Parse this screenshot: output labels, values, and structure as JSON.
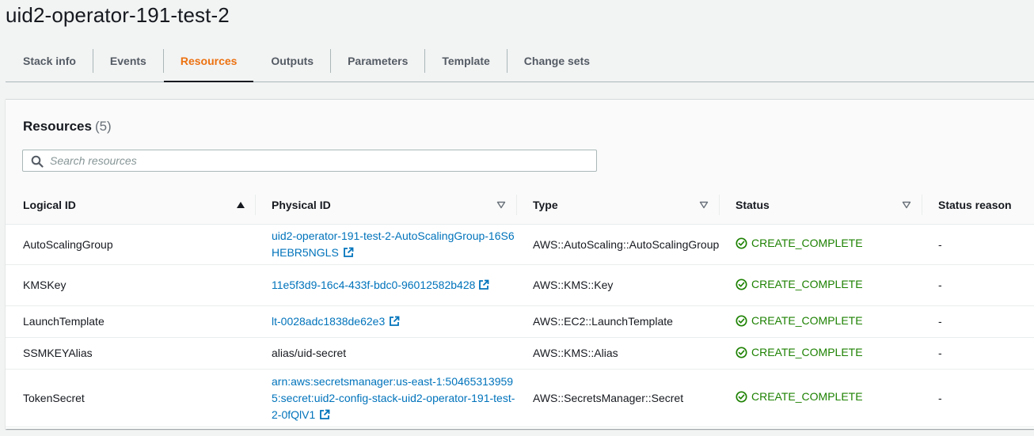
{
  "page": {
    "title": "uid2-operator-191-test-2"
  },
  "tabs": [
    {
      "label": "Stack info",
      "active": false
    },
    {
      "label": "Events",
      "active": false
    },
    {
      "label": "Resources",
      "active": true
    },
    {
      "label": "Outputs",
      "active": false
    },
    {
      "label": "Parameters",
      "active": false
    },
    {
      "label": "Template",
      "active": false
    },
    {
      "label": "Change sets",
      "active": false
    }
  ],
  "resources_panel": {
    "title": "Resources",
    "count": "(5)",
    "search_placeholder": "Search resources"
  },
  "table": {
    "columns": [
      {
        "label": "Logical ID",
        "sort": "ascending"
      },
      {
        "label": "Physical ID",
        "sort": "none"
      },
      {
        "label": "Type",
        "sort": "none"
      },
      {
        "label": "Status",
        "sort": "none"
      },
      {
        "label": "Status reason",
        "sort": "none"
      }
    ],
    "rows": [
      {
        "logical_id": "AutoScalingGroup",
        "physical_id": "uid2-operator-191-test-2-AutoScalingGroup-16S6HEBR5NGLS",
        "physical_is_link": true,
        "type": "AWS::AutoScaling::AutoScalingGroup",
        "status": "CREATE_COMPLETE",
        "status_reason": "-"
      },
      {
        "logical_id": "KMSKey",
        "physical_id": "11e5f3d9-16c4-433f-bdc0-96012582b428",
        "physical_is_link": true,
        "type": "AWS::KMS::Key",
        "status": "CREATE_COMPLETE",
        "status_reason": "-"
      },
      {
        "logical_id": "LaunchTemplate",
        "physical_id": "lt-0028adc1838de62e3",
        "physical_is_link": true,
        "type": "AWS::EC2::LaunchTemplate",
        "status": "CREATE_COMPLETE",
        "status_reason": "-"
      },
      {
        "logical_id": "SSMKEYAlias",
        "physical_id": "alias/uid-secret",
        "physical_is_link": false,
        "type": "AWS::KMS::Alias",
        "status": "CREATE_COMPLETE",
        "status_reason": "-"
      },
      {
        "logical_id": "TokenSecret",
        "physical_id": "arn:aws:secretsmanager:us-east-1:504653139595:secret:uid2-config-stack-uid2-operator-191-test-2-0fQlV1",
        "physical_is_link": true,
        "type": "AWS::SecretsManager::Secret",
        "status": "CREATE_COMPLETE",
        "status_reason": "-"
      }
    ]
  },
  "colors": {
    "accent_tab": "#ec7211",
    "link": "#0073bb",
    "success": "#1d8102"
  },
  "icons": {
    "search": "search-icon",
    "external_link": "external-link-icon",
    "status_success": "check-circle-icon",
    "sort_ascending": "caret-up-icon",
    "sort_none": "caret-down-outline-icon"
  }
}
